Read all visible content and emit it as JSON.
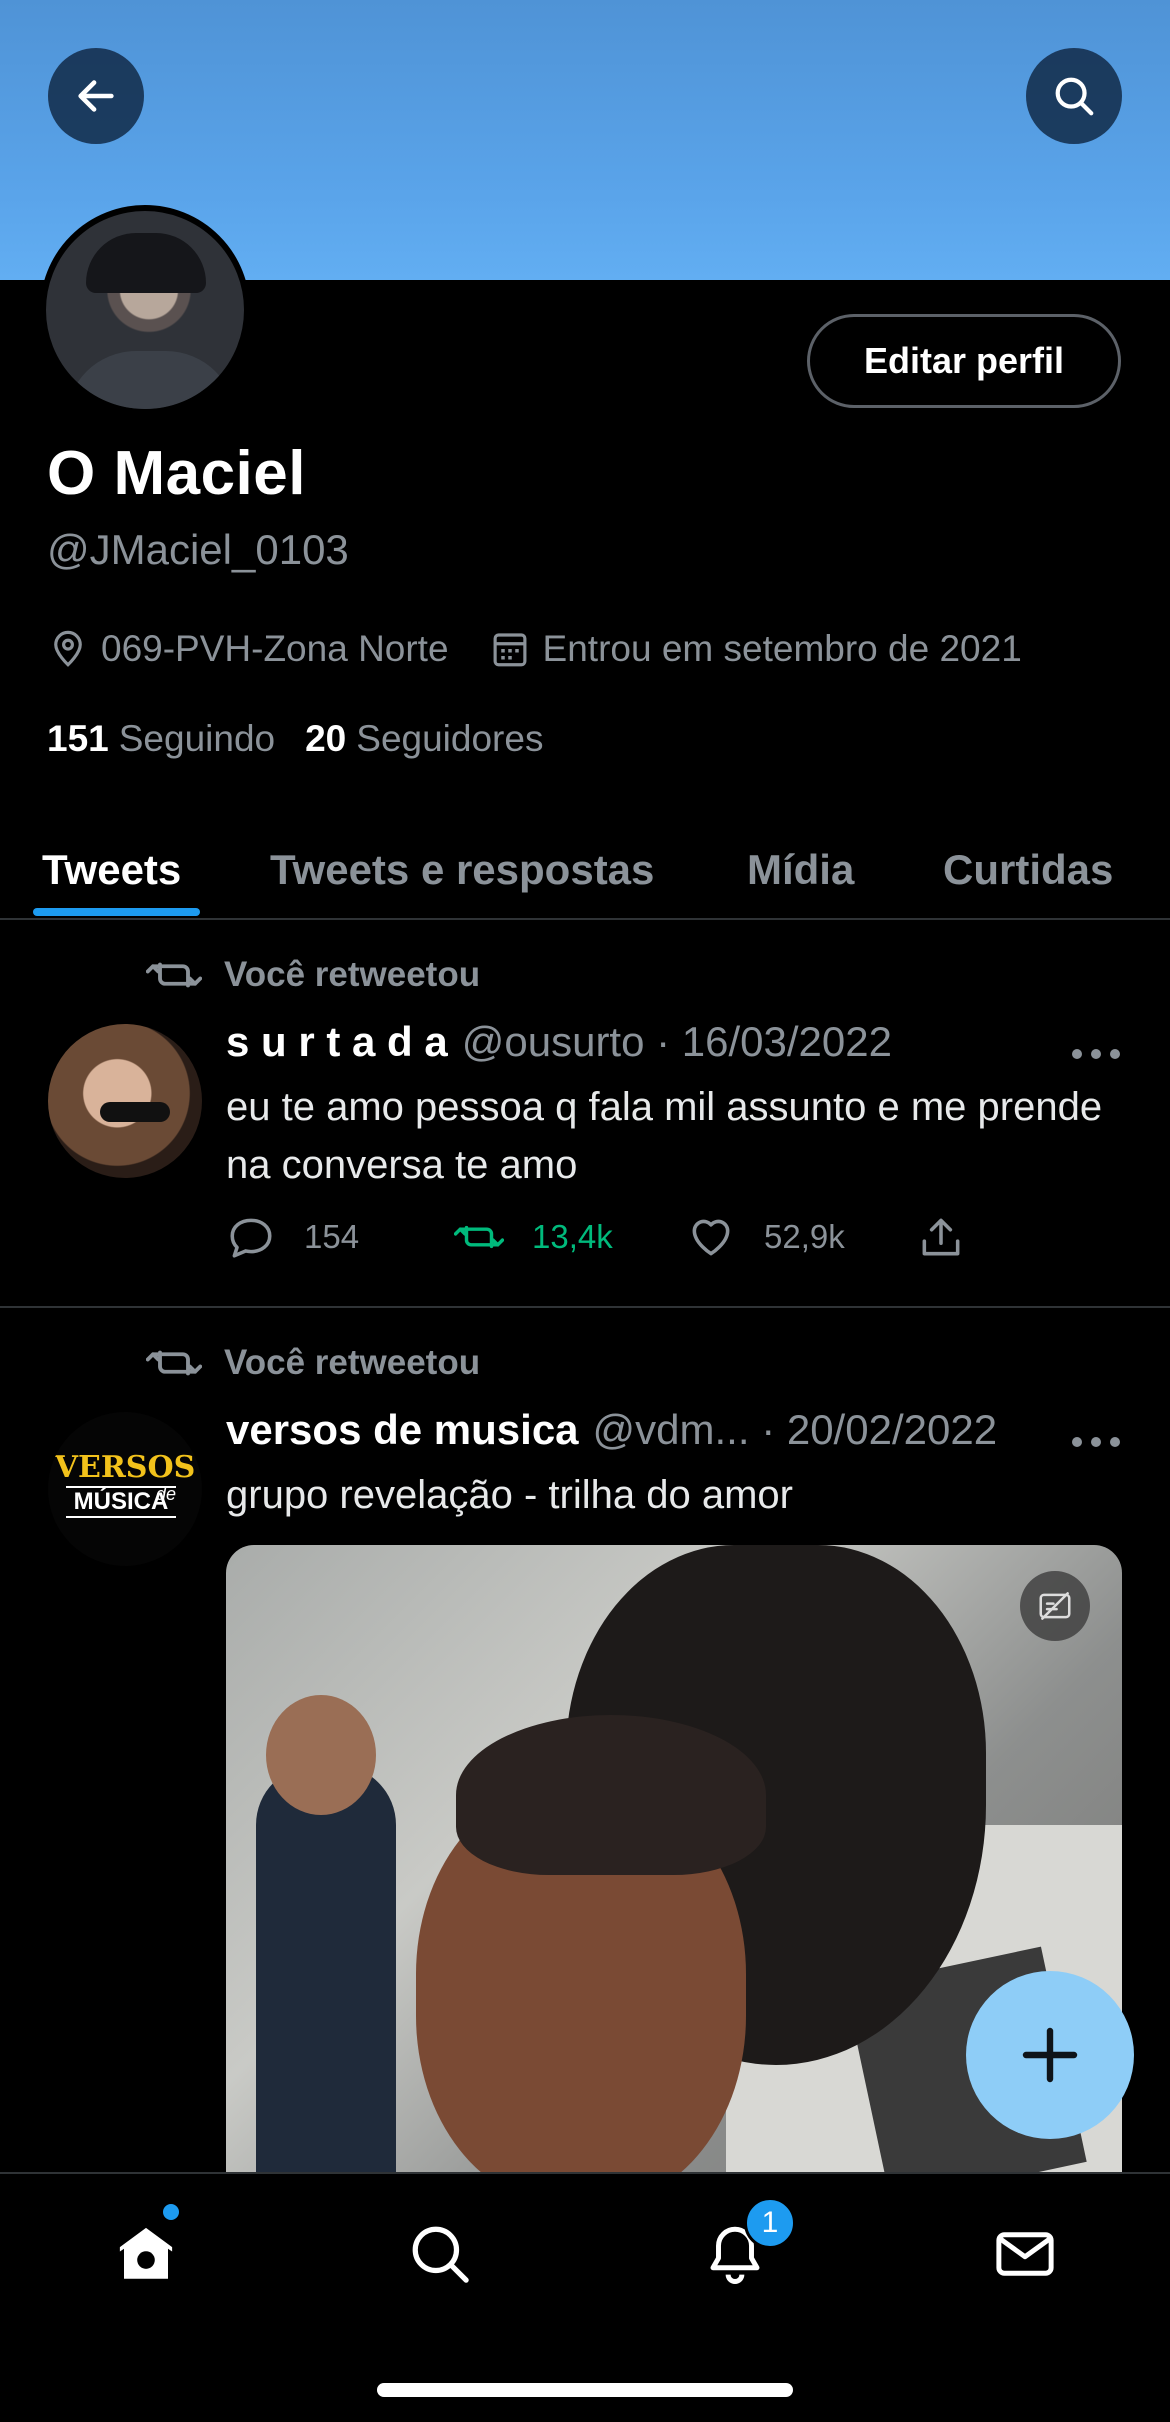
{
  "profile": {
    "edit_label": "Editar perfil",
    "name": "O Maciel",
    "handle": "@JMaciel_0103",
    "location": "069-PVH-Zona Norte",
    "joined": "Entrou em setembro de 2021",
    "following_count": "151",
    "following_label": "Seguindo",
    "followers_count": "20",
    "followers_label": "Seguidores"
  },
  "tabs": [
    {
      "label": "Tweets",
      "active": true
    },
    {
      "label": "Tweets e respostas",
      "active": false
    },
    {
      "label": "Mídia",
      "active": false
    },
    {
      "label": "Curtidas",
      "active": false
    }
  ],
  "tweets": [
    {
      "retweet_label": "Você retweetou",
      "author": "s u r t a d a",
      "meta": "@ousurto · 16/03/2022",
      "text": "eu te amo pessoa q fala mil assunto  e me prende na conversa   te amo",
      "replies": "154",
      "retweets": "13,4k",
      "likes": "52,9k"
    },
    {
      "retweet_label": "Você retweetou",
      "author": "versos de musica",
      "meta": "@vdm... · 20/02/2022",
      "text": "grupo revelação - trilha do amor",
      "avatar_text_1": "VERSOS",
      "avatar_text_2": "de",
      "avatar_text_3": "MÚSICA"
    }
  ],
  "notifications_badge": "1",
  "colors": {
    "accent": "#1d9bf0",
    "retweet_green": "#00ba7c",
    "secondary_text": "#8b9299",
    "fab": "#8ecdf7"
  }
}
